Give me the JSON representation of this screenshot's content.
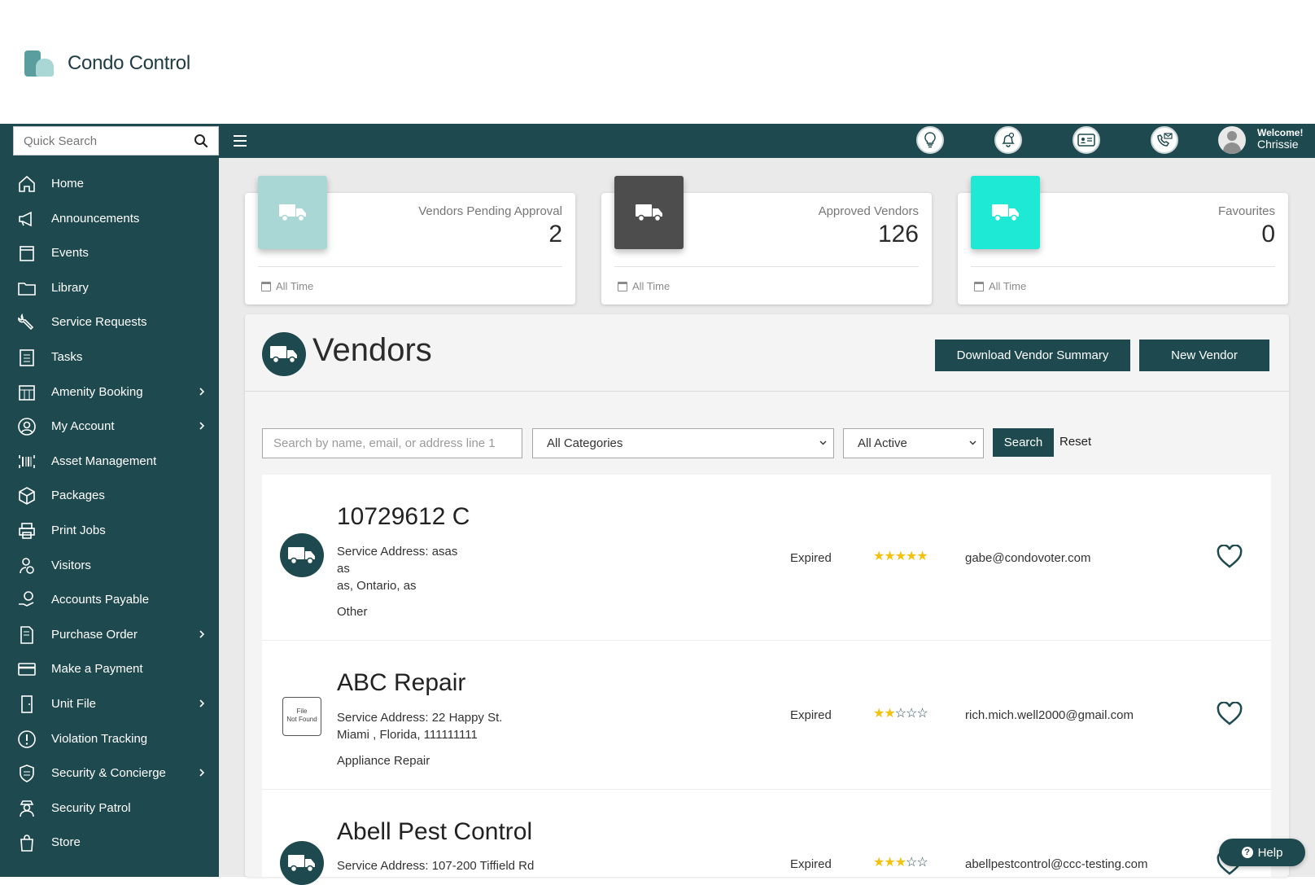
{
  "app": {
    "name": "Condo Control"
  },
  "topbar": {
    "search_placeholder": "Quick Search",
    "welcome_label": "Welcome!",
    "user_name": "Chrissie",
    "icons": [
      "lightbulb-icon",
      "bell-icon",
      "id-card-icon",
      "phone-mail-icon"
    ]
  },
  "sidebar": {
    "items": [
      {
        "label": "Home",
        "icon": "home-icon",
        "has_submenu": false
      },
      {
        "label": "Announcements",
        "icon": "megaphone-icon",
        "has_submenu": false
      },
      {
        "label": "Events",
        "icon": "calendar-icon",
        "has_submenu": false
      },
      {
        "label": "Library",
        "icon": "folder-icon",
        "has_submenu": false
      },
      {
        "label": "Service Requests",
        "icon": "wrench-icon",
        "has_submenu": false
      },
      {
        "label": "Tasks",
        "icon": "checklist-icon",
        "has_submenu": false
      },
      {
        "label": "Amenity Booking",
        "icon": "calendar-grid-icon",
        "has_submenu": true
      },
      {
        "label": "My Account",
        "icon": "user-circle-icon",
        "has_submenu": true
      },
      {
        "label": "Asset Management",
        "icon": "barcode-icon",
        "has_submenu": false
      },
      {
        "label": "Packages",
        "icon": "package-icon",
        "has_submenu": false
      },
      {
        "label": "Print Jobs",
        "icon": "printer-icon",
        "has_submenu": false
      },
      {
        "label": "Visitors",
        "icon": "visitor-icon",
        "has_submenu": false
      },
      {
        "label": "Accounts Payable",
        "icon": "money-hand-icon",
        "has_submenu": false
      },
      {
        "label": "Purchase Order",
        "icon": "document-po-icon",
        "has_submenu": true
      },
      {
        "label": "Make a Payment",
        "icon": "credit-card-icon",
        "has_submenu": false
      },
      {
        "label": "Unit File",
        "icon": "door-icon",
        "has_submenu": true
      },
      {
        "label": "Violation Tracking",
        "icon": "alert-circle-icon",
        "has_submenu": false
      },
      {
        "label": "Security & Concierge",
        "icon": "shield-icon",
        "has_submenu": true
      },
      {
        "label": "Security Patrol",
        "icon": "guard-icon",
        "has_submenu": false
      },
      {
        "label": "Store",
        "icon": "shopping-bag-icon",
        "has_submenu": false
      }
    ]
  },
  "stats": [
    {
      "title": "Vendors Pending Approval",
      "value": "2",
      "footer": "All Time",
      "tile_color": "#a9d7d6"
    },
    {
      "title": "Approved Vendors",
      "value": "126",
      "footer": "All Time",
      "tile_color": "#4d4d4d"
    },
    {
      "title": "Favourites",
      "value": "0",
      "footer": "All Time",
      "tile_color": "#1de9d4"
    }
  ],
  "vendors_page": {
    "title": "Vendors",
    "download_label": "Download Vendor Summary",
    "new_label": "New Vendor",
    "filters": {
      "search_placeholder": "Search by name, email, or address line 1",
      "category_selected": "All Categories",
      "status_selected": "All Active",
      "search_label": "Search",
      "reset_label": "Reset"
    },
    "vendors": [
      {
        "name": "10729612 C",
        "address_lines": [
          "Service Address: asas",
          "as",
          "as, Ontario, as"
        ],
        "category": "Other",
        "status": "Expired",
        "rating": 5,
        "email": "gabe@condovoter.com",
        "logo": "truck-icon"
      },
      {
        "name": "ABC Repair",
        "address_lines": [
          "Service Address: 22 Happy St.",
          "Miami , Florida, 111111111"
        ],
        "category": "Appliance Repair",
        "status": "Expired",
        "rating": 2,
        "email": "rich.mich.well2000@gmail.com",
        "logo": "file-not-found",
        "logo_text": [
          "File",
          "Not Found"
        ]
      },
      {
        "name": "Abell Pest Control",
        "address_lines": [
          "Service Address: 107-200 Tiffield Rd"
        ],
        "category": "",
        "status": "Expired",
        "rating": 3,
        "email": "abellpestcontrol@ccc-testing.com",
        "logo": "truck-icon"
      }
    ]
  },
  "help": {
    "label": "Help"
  },
  "colors": {
    "primary": "#1e4a4f",
    "star": "#f3c20f",
    "background": "#eaeaea"
  }
}
